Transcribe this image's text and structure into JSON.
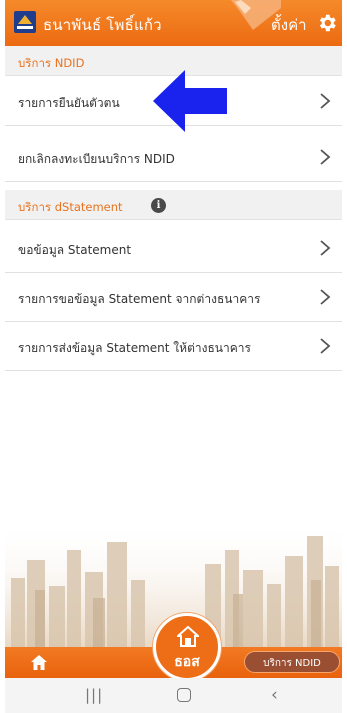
{
  "header": {
    "title": "ธนาพันธ์ โพธิ์แก้ว",
    "settings_label": "ตั้งค่า",
    "color": "#ec6a12"
  },
  "sections": [
    {
      "label": "บริการ NDID",
      "items": [
        {
          "label": "รายการยืนยันตัวตน"
        },
        {
          "label": "ยกเลิกลงทะเบียนบริการ NDID"
        }
      ]
    },
    {
      "label": "บริการ dStatement",
      "items": [
        {
          "label": "ขอข้อมูล Statement"
        },
        {
          "label": "รายการขอข้อมูล Statement จากต่างธนาคาร"
        },
        {
          "label": "รายการส่งข้อมูล Statement ให้ต่างธนาคาร"
        }
      ]
    }
  ],
  "bottom_bar": {
    "center_label": "ธอส",
    "ndid_button": "บริการ NDID"
  },
  "icons": [
    "bank-logo-icon",
    "gear-icon",
    "info-icon",
    "chevron-right-icon",
    "home-icon",
    "recent-apps-icon",
    "android-home-icon",
    "back-icon"
  ],
  "annotation_color": "#1a22ee"
}
